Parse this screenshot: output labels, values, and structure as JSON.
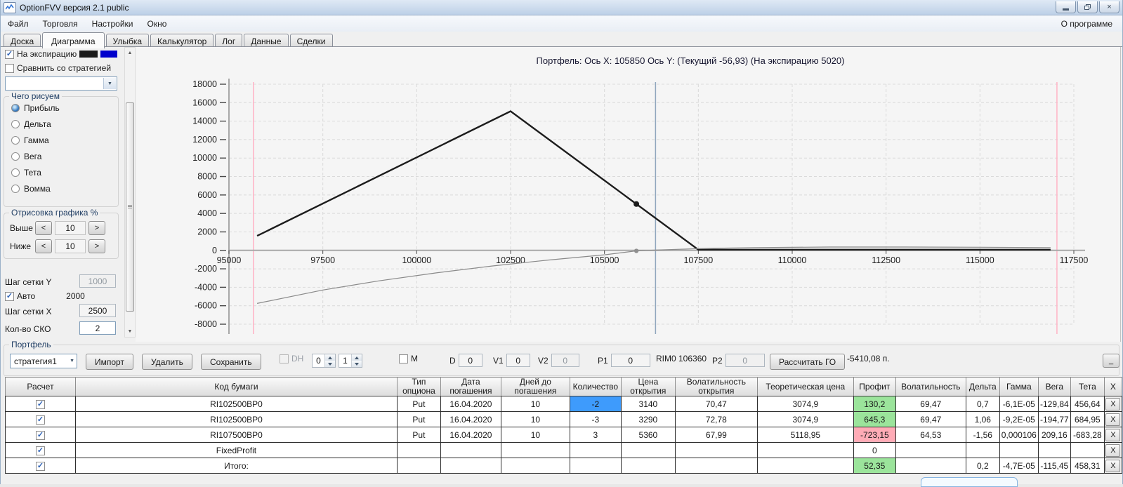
{
  "window": {
    "title": "OptionFVV версия 2.1 public"
  },
  "menu": {
    "items": [
      "Файл",
      "Торговля",
      "Настройки",
      "Окно"
    ],
    "right": "О программе"
  },
  "tabs": [
    "Доска",
    "Диаграмма",
    "Улыбка",
    "Калькулятор",
    "Лог",
    "Данные",
    "Сделки"
  ],
  "active_tab": "Диаграмма",
  "sidebar": {
    "expiration_checkbox": "На экспирацию",
    "swatches": [
      "#1a1a1a",
      "#0000cc"
    ],
    "compare_checkbox": "Сравнить со стратегией",
    "strategy_dropdown_value": "",
    "draw_group": {
      "label": "Чего рисуем",
      "options": [
        "Прибыль",
        "Дельта",
        "Гамма",
        "Вега",
        "Тета",
        "Вомма"
      ],
      "selected": "Прибыль"
    },
    "render_group": {
      "label": "Отрисовка графика %",
      "rows": [
        {
          "label": "Выше",
          "value": "10"
        },
        {
          "label": "Ниже",
          "value": "10"
        }
      ]
    },
    "grid_y_label": "Шаг сетки Y",
    "grid_y_value": "1000",
    "auto_checkbox": "Авто",
    "auto_value": "2000",
    "grid_x_label": "Шаг сетки X",
    "grid_x_value": "2500",
    "sko_label": "Кол-во СКО",
    "sko_value": "2"
  },
  "chart_data": {
    "type": "line",
    "title": "Портфель: Ось X: 105850 Ось Y:   (Текущий -56,93)   (На экспирацию 5020)",
    "x_range": [
      95000,
      117500
    ],
    "y_range": [
      -8000,
      18000
    ],
    "x_ticks": [
      95000,
      97500,
      100000,
      102500,
      105000,
      107500,
      110000,
      112500,
      115000,
      117500
    ],
    "y_ticks": [
      -8000,
      -6000,
      -4000,
      -2000,
      0,
      2000,
      4000,
      6000,
      8000,
      10000,
      12000,
      14000,
      16000,
      18000
    ],
    "grid": true,
    "cursor_x": 105850,
    "series": [
      {
        "name": "На экспирацию",
        "color": "#1c1c1c",
        "width": 2.4,
        "points": [
          [
            95750,
            1570
          ],
          [
            102500,
            15070
          ],
          [
            107500,
            70
          ],
          [
            116880,
            70
          ]
        ]
      },
      {
        "name": "Текущий",
        "color": "#8a8a8a",
        "width": 1.2,
        "points": [
          [
            95750,
            -5750
          ],
          [
            97500,
            -4300
          ],
          [
            99000,
            -3300
          ],
          [
            100500,
            -2450
          ],
          [
            102000,
            -1700
          ],
          [
            103500,
            -1050
          ],
          [
            105000,
            -480
          ],
          [
            105850,
            -57
          ],
          [
            106360,
            30
          ],
          [
            107500,
            190
          ],
          [
            109000,
            300
          ],
          [
            111000,
            360
          ],
          [
            113000,
            365
          ],
          [
            115000,
            340
          ],
          [
            116880,
            300
          ]
        ]
      }
    ],
    "markers": [
      {
        "x": 105850,
        "y": 5020,
        "color": "#1c1c1c",
        "r": 4
      },
      {
        "x": 105850,
        "y": -57,
        "color": "#8f8f8f",
        "r": 3.2
      }
    ],
    "vlines": [
      {
        "x": 95650,
        "color": "#ffb3c6",
        "width": 1.5,
        "name": "sko-left"
      },
      {
        "x": 117050,
        "color": "#ffb3c6",
        "width": 1.5,
        "name": "sko-right"
      },
      {
        "x": 106360,
        "color": "#8fa6bd",
        "width": 1.5,
        "name": "current-price"
      }
    ]
  },
  "portfolio": {
    "group_label": "Портфель",
    "strategy_value": "стратегия1",
    "import_label": "Импорт",
    "delete_label": "Удалить",
    "save_label": "Сохранить",
    "dh_label": "DH",
    "spin1": "0",
    "spin2": "1",
    "m_label": "M",
    "d_label": "D",
    "d_value": "0",
    "v1_label": "V1",
    "v1_value": "0",
    "v2_label": "V2",
    "v2_value": "0",
    "p1_label": "P1",
    "p1_value": "0",
    "rim_label": "RIM0 106360",
    "p2_label": "P2",
    "p2_value": "0",
    "calc_go_label": "Рассчитать ГО",
    "go_result": "-5410,08 п.",
    "mini_button": "_"
  },
  "table": {
    "headers": [
      "Расчет",
      "Код бумаги",
      "Тип опциона",
      "Дата погашения",
      "Дней до погашения",
      "Количество",
      "Цена открытия",
      "Волатильность открытия",
      "Теоретическая цена",
      "Профит",
      "Волатильность",
      "Дельта",
      "Гамма",
      "Вега",
      "Тета",
      "X"
    ],
    "colors": {
      "qty_selected": "#3e9bfc",
      "profit_green": "#9be49b",
      "profit_red": "#ffabb6"
    },
    "x_button": "X",
    "rows": [
      {
        "checked": true,
        "qty_selected": true,
        "profit": "green",
        "cells": [
          "RI102500BP0",
          "Put",
          "16.04.2020",
          "10",
          "-2",
          "3140",
          "70,47",
          "3074,9",
          "130,2",
          "69,47",
          "0,7",
          "-6,1E-05",
          "-129,84",
          "456,64"
        ]
      },
      {
        "checked": true,
        "qty_selected": false,
        "profit": "green",
        "cells": [
          "RI102500BP0",
          "Put",
          "16.04.2020",
          "10",
          "-3",
          "3290",
          "72,78",
          "3074,9",
          "645,3",
          "69,47",
          "1,06",
          "-9,2E-05",
          "-194,77",
          "684,95"
        ]
      },
      {
        "checked": true,
        "qty_selected": false,
        "profit": "red",
        "cells": [
          "RI107500BP0",
          "Put",
          "16.04.2020",
          "10",
          "3",
          "5360",
          "67,99",
          "5118,95",
          "-723,15",
          "64,53",
          "-1,56",
          "0,000106",
          "209,16",
          "-683,28"
        ]
      },
      {
        "checked": true,
        "qty_selected": false,
        "profit": "none",
        "cells": [
          "FixedProfit",
          "",
          "",
          "",
          "",
          "",
          "",
          "",
          "0",
          "",
          "",
          "",
          "",
          ""
        ]
      },
      {
        "checked": true,
        "qty_selected": false,
        "profit": "green",
        "cells": [
          "Итого:",
          "",
          "",
          "",
          "",
          "",
          "",
          "",
          "52,35",
          "",
          "0,2",
          "-4,7E-05",
          "-115,45",
          "458,31"
        ]
      }
    ]
  }
}
